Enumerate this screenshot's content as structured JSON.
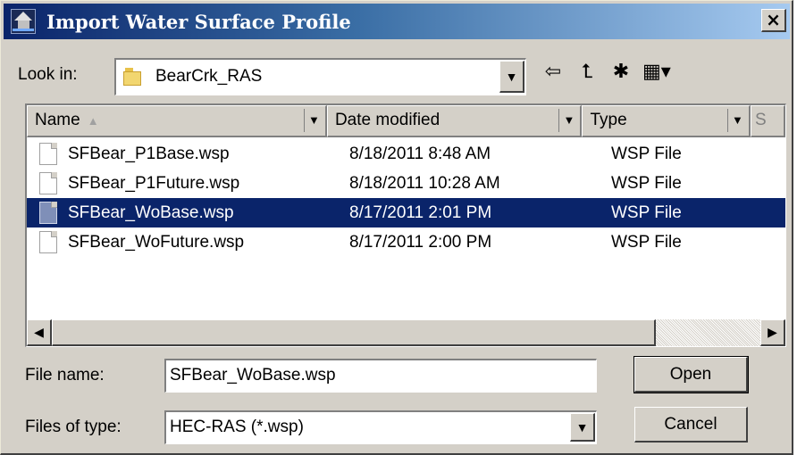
{
  "window": {
    "title": "Import Water Surface Profile",
    "close_label": "×"
  },
  "look_in": {
    "label": "Look in:",
    "value": "BearCrk_RAS"
  },
  "toolbar": {
    "icons": [
      "back-arrow-icon",
      "up-folder-icon",
      "new-folder-icon",
      "view-menu-icon"
    ]
  },
  "file_list": {
    "columns": [
      {
        "label": "Name",
        "sort": "ascending"
      },
      {
        "label": "Date modified"
      },
      {
        "label": "Type"
      },
      {
        "label": "S"
      }
    ],
    "rows": [
      {
        "name": "SFBear_P1Base.wsp",
        "date": "8/18/2011 8:48 AM",
        "type": "WSP File",
        "selected": false
      },
      {
        "name": "SFBear_P1Future.wsp",
        "date": "8/18/2011 10:28 AM",
        "type": "WSP File",
        "selected": false
      },
      {
        "name": "SFBear_WoBase.wsp",
        "date": "8/17/2011 2:01 PM",
        "type": "WSP File",
        "selected": true
      },
      {
        "name": "SFBear_WoFuture.wsp",
        "date": "8/17/2011 2:00 PM",
        "type": "WSP File",
        "selected": false
      }
    ]
  },
  "file_name": {
    "label": "File name:",
    "value": "SFBear_WoBase.wsp"
  },
  "file_type": {
    "label": "Files of type:",
    "value": "HEC-RAS (*.wsp)"
  },
  "buttons": {
    "open": "Open",
    "cancel": "Cancel"
  },
  "colors": {
    "title_gradient_start": "#0a246a",
    "title_gradient_end": "#a6caf0",
    "selection": "#0a246a",
    "dialog_face": "#d4d0c8"
  }
}
